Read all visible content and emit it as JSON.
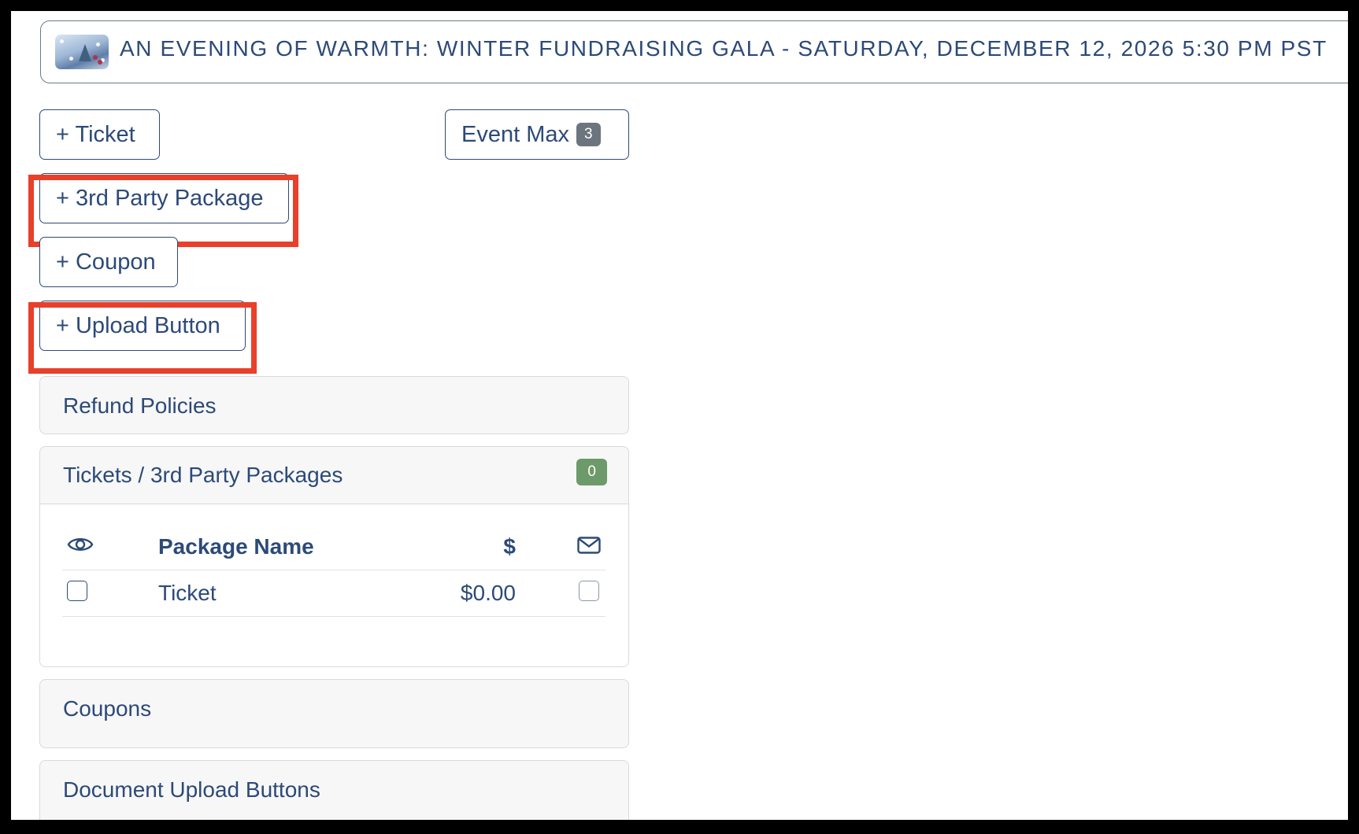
{
  "event": {
    "title": "AN EVENING OF WARMTH: WINTER FUNDRAISING GALA - SATURDAY, DECEMBER 12, 2026 5:30 PM PST"
  },
  "actions": {
    "ticket_label": "+ Ticket",
    "event_max_label": "Event Max",
    "event_max_count": "3",
    "third_party_label": "+ 3rd Party Package",
    "coupon_label": "+ Coupon",
    "upload_label": "+ Upload Button"
  },
  "panels": {
    "refund": {
      "title": "Refund Policies"
    },
    "tickets": {
      "title": "Tickets / 3rd Party Packages",
      "count": "0",
      "columns": {
        "visible_icon": "eye-icon",
        "name": "Package Name",
        "price": "$",
        "email_icon": "envelope-icon"
      },
      "rows": [
        {
          "name": "Ticket",
          "price": "$0.00",
          "visible_checked": false,
          "email_checked": false
        }
      ]
    },
    "coupons": {
      "title": "Coupons"
    },
    "documents": {
      "title": "Document Upload Buttons"
    }
  },
  "colors": {
    "text": "#2c4a78",
    "highlight": "#e8402a",
    "badge_gray": "#6c757d",
    "badge_green": "#6c9a6a",
    "panel_bg": "#f7f7f7"
  }
}
